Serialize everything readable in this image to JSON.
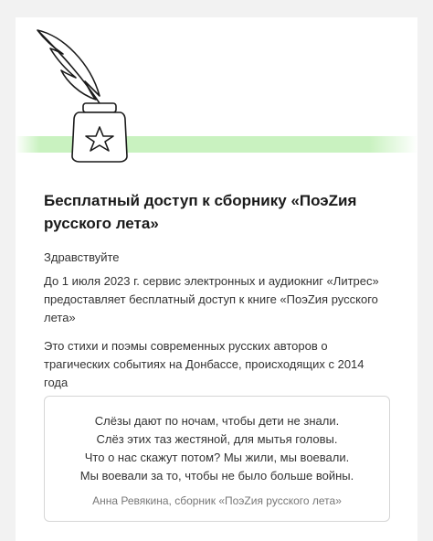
{
  "email": {
    "title": "Бесплатный доступ к сборнику «ПоэZия русского лета»",
    "greeting": "Здравствуйте",
    "paragraph1": "До 1 июля 2023 г. сервис электронных и аудиокниг «Литрес» предоставляет бесплатный доступ к книге «ПоэZия русского лета»",
    "paragraph2": "Это стихи и поэмы современных русских авторов о трагических событиях на Донбассе, происходящих с 2014 года"
  },
  "quote": {
    "lines": [
      "Слёзы дают по ночам, чтобы дети не знали.",
      "Слёз этих таз жестяной, для мытья головы.",
      "Что о нас скажут потом? Мы жили, мы воевали.",
      "Мы воевали за то, чтобы не было больше войны."
    ],
    "author": "Анна Ревякина, сборник «ПоэZия русского лета»"
  },
  "illustration": {
    "icon": "quill-inkwell-icon",
    "accent_color": "#c9f2c0"
  }
}
